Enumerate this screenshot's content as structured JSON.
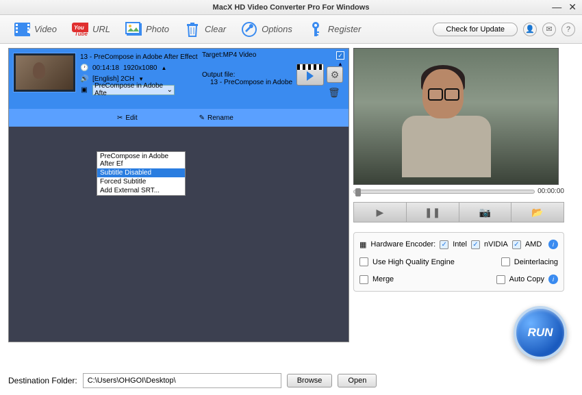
{
  "app": {
    "title": "MacX HD Video Converter Pro For Windows"
  },
  "toolbar": {
    "video": "Video",
    "url": "URL",
    "photo": "Photo",
    "clear": "Clear",
    "options": "Options",
    "register": "Register",
    "update": "Check for Update"
  },
  "item": {
    "title": "13 - PreCompose in Adobe After Effect",
    "target_label": "Target:MP4 Video",
    "duration": "00:14:18",
    "resolution": "1920x1080",
    "audio": "[English] 2CH",
    "subtitle_selected": "PreCompose in Adobe Afte",
    "output_label": "Output file:",
    "output_file": "13 - PreCompose in Adobe"
  },
  "subtitle_options": [
    "PreCompose in Adobe After Ef",
    "Subtitle Disabled",
    "Forced Subtitle",
    "Add External SRT..."
  ],
  "actions": {
    "edit": "Edit",
    "rename": "Rename"
  },
  "preview": {
    "time": "00:00:00"
  },
  "encoder": {
    "hw_label": "Hardware Encoder:",
    "intel": "Intel",
    "nvidia": "nVIDIA",
    "amd": "AMD",
    "hq": "Use High Quality Engine",
    "deint": "Deinterlacing",
    "merge": "Merge",
    "autocopy": "Auto Copy"
  },
  "run": "RUN",
  "dest": {
    "label": "Destination Folder:",
    "path": "C:\\Users\\OHGOI\\Desktop\\",
    "browse": "Browse",
    "open": "Open"
  }
}
